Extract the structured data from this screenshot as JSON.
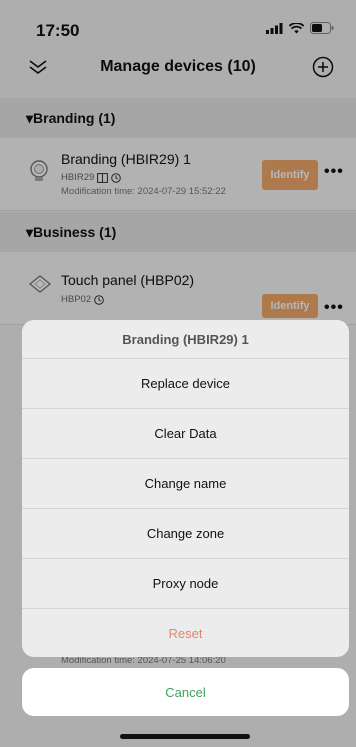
{
  "status_bar": {
    "time": "17:50"
  },
  "nav": {
    "title": "Manage devices (10)"
  },
  "sections": [
    {
      "header": "▾Branding (1)"
    },
    {
      "header": "▾Business (1)"
    }
  ],
  "devices": [
    {
      "name": "Branding (HBIR29) 1",
      "model": "HBIR29",
      "modification": "Modification time: 2024-07-29 15:52:22",
      "identify_label": "Identify"
    },
    {
      "name": "Touch panel  (HBP02)",
      "model": "HBP02",
      "identify_label": "Identify"
    }
  ],
  "peek": {
    "modification": "Modification time: 2024-07-25 14:06:20"
  },
  "action_sheet": {
    "title": "Branding (HBIR29) 1",
    "options": [
      "Replace device",
      "Clear Data",
      "Change name",
      "Change zone",
      "Proxy node",
      "Reset"
    ],
    "cancel_label": "Cancel"
  },
  "colors": {
    "accent_orange": "#f2a86a",
    "cancel_green": "#3da35d",
    "reset_red": "#e8836b"
  },
  "icons": {
    "nav_left": "double-chevron-down-icon",
    "nav_right": "add-circle-icon"
  }
}
